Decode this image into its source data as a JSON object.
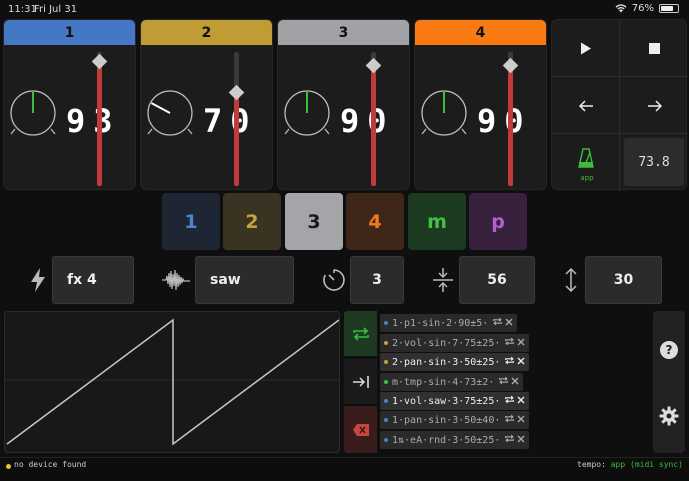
{
  "status_bar": {
    "time": "11:31",
    "date": "Fri Jul 31",
    "battery": "76%",
    "battery_level": 0.76
  },
  "channels": [
    {
      "label": "1",
      "value": "93",
      "color": "#4477c4",
      "knob_angle_deg": 0,
      "knob_color": "#39c03a",
      "fader_level": 0.93
    },
    {
      "label": "2",
      "value": "70",
      "color": "#c09c35",
      "knob_angle_deg": -62,
      "knob_color": "#ffffff",
      "fader_level": 0.7
    },
    {
      "label": "3",
      "value": "90",
      "color": "#a0a2a5",
      "knob_angle_deg": 0,
      "knob_color": "#39c03a",
      "fader_level": 0.9
    },
    {
      "label": "4",
      "value": "90",
      "color": "#f97a12",
      "knob_angle_deg": 0,
      "knob_color": "#39c03a",
      "fader_level": 0.9
    }
  ],
  "transport": {
    "bpm": "73.8",
    "metronome_label": "app",
    "play_icon": "play-icon",
    "stop_icon": "stop-icon"
  },
  "modes": [
    {
      "label": "1",
      "bg": "#1e2634",
      "fg": "#4e82c9"
    },
    {
      "label": "2",
      "bg": "#3a3321",
      "fg": "#c3a23f"
    },
    {
      "label": "3",
      "bg": "#a3a5a8",
      "fg": "#1a1a1a",
      "selected": true
    },
    {
      "label": "4",
      "bg": "#3e2718",
      "fg": "#f07b1c"
    },
    {
      "label": "m",
      "bg": "#1c3a1f",
      "fg": "#40c044"
    },
    {
      "label": "p",
      "bg": "#37213c",
      "fg": "#b35ed1"
    }
  ],
  "params": {
    "fx": "fx 4",
    "waveform": "saw",
    "rate": "3",
    "center": "56",
    "amount": "30"
  },
  "lfo_list": [
    {
      "text": "1·p1·sin·2·90±5·",
      "color": "#4d7fc6",
      "active": false
    },
    {
      "text": "2·vol·sin·7·75±25·",
      "color": "#c2a23b",
      "active": false
    },
    {
      "text": "2·pan·sin·3·50±25·",
      "color": "#c2a23b",
      "active": true
    },
    {
      "text": "m·tmp·sin·4·73±2·",
      "color": "#3fbf42",
      "active": false
    },
    {
      "text": "1·vol·saw·3·75±25·",
      "color": "#4d7fc6",
      "active": true
    },
    {
      "text": "1·pan·sin·3·50±40·",
      "color": "#4d7fc6",
      "active": false
    },
    {
      "text": "1⇅·eA·rnd·3·50±25·",
      "color": "#4d7fc6",
      "active": false
    }
  ],
  "footer": {
    "message": "no device found",
    "tempo_label": "tempo:",
    "tempo_source": "app",
    "tempo_mode": "(midi sync)"
  },
  "colors": {
    "accent_green": "#3cbc3c",
    "fader_red": "#c23b3b",
    "delete_red": "#c9453f"
  }
}
